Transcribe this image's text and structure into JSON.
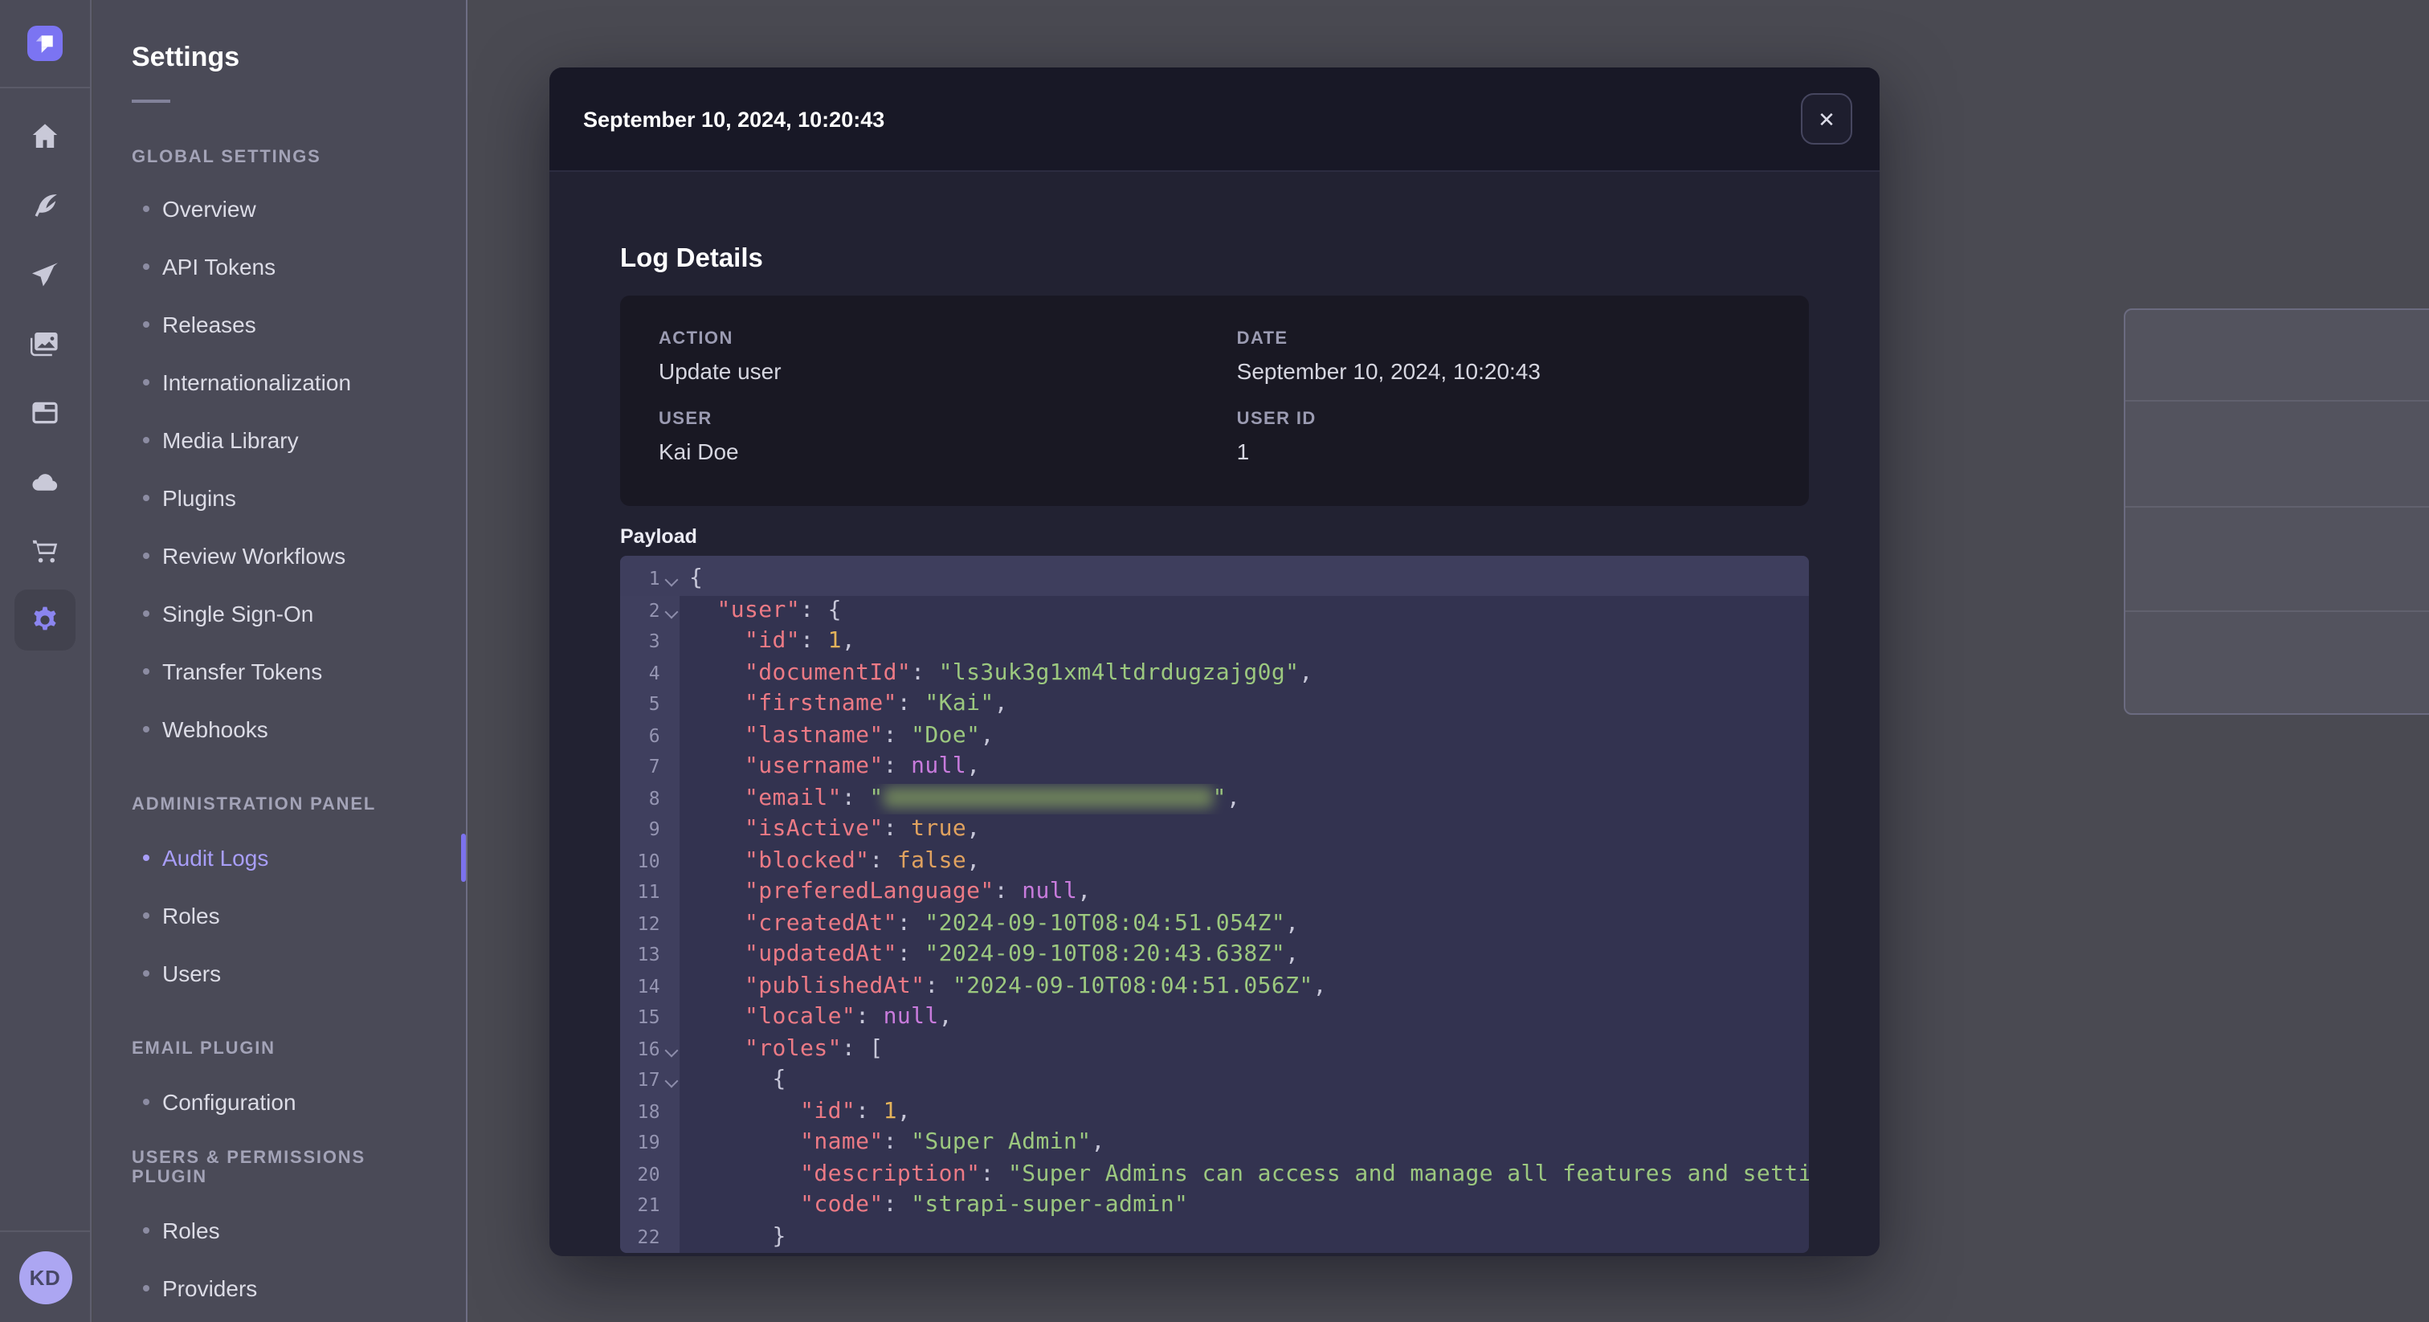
{
  "rail": {
    "logo_icon": "strapi-logo-icon",
    "items": [
      {
        "icon": "home-icon"
      },
      {
        "icon": "feather-icon"
      },
      {
        "icon": "send-icon"
      },
      {
        "icon": "media-library-icon"
      },
      {
        "icon": "layout-icon"
      },
      {
        "icon": "cloud-icon"
      },
      {
        "icon": "cart-icon"
      },
      {
        "icon": "gear-icon",
        "active": true
      }
    ],
    "avatar_initials": "KD"
  },
  "settings_nav": {
    "title": "Settings",
    "sections": [
      {
        "label": "GLOBAL SETTINGS",
        "items": [
          {
            "label": "Overview"
          },
          {
            "label": "API Tokens"
          },
          {
            "label": "Releases"
          },
          {
            "label": "Internationalization"
          },
          {
            "label": "Media Library"
          },
          {
            "label": "Plugins"
          },
          {
            "label": "Review Workflows"
          },
          {
            "label": "Single Sign-On"
          },
          {
            "label": "Transfer Tokens"
          },
          {
            "label": "Webhooks"
          }
        ]
      },
      {
        "label": "ADMINISTRATION PANEL",
        "items": [
          {
            "label": "Audit Logs",
            "active": true
          },
          {
            "label": "Roles"
          },
          {
            "label": "Users"
          }
        ]
      },
      {
        "label": "EMAIL PLUGIN",
        "items": [
          {
            "label": "Configuration"
          }
        ]
      },
      {
        "label": "USERS & PERMISSIONS PLUGIN",
        "items": [
          {
            "label": "Roles"
          },
          {
            "label": "Providers"
          }
        ]
      }
    ]
  },
  "modal": {
    "title": "September 10, 2024, 10:20:43",
    "close_label": "✕",
    "section_heading": "Log Details",
    "details": {
      "action_label": "ACTION",
      "action_value": "Update user",
      "date_label": "DATE",
      "date_value": "September 10, 2024, 10:20:43",
      "user_label": "USER",
      "user_value": "Kai Doe",
      "user_id_label": "USER ID",
      "user_id_value": "1"
    },
    "payload_label": "Payload",
    "payload": {
      "lines": [
        {
          "n": 1,
          "fold": true,
          "active": true,
          "t": [
            [
              "p",
              "{"
            ]
          ]
        },
        {
          "n": 2,
          "fold": true,
          "t": [
            [
              "p",
              "  "
            ],
            [
              "k",
              "\"user\""
            ],
            [
              "p",
              ": {"
            ]
          ]
        },
        {
          "n": 3,
          "t": [
            [
              "p",
              "    "
            ],
            [
              "k",
              "\"id\""
            ],
            [
              "p",
              ": "
            ],
            [
              "n",
              "1"
            ],
            [
              "p",
              ","
            ]
          ]
        },
        {
          "n": 4,
          "t": [
            [
              "p",
              "    "
            ],
            [
              "k",
              "\"documentId\""
            ],
            [
              "p",
              ": "
            ],
            [
              "s",
              "\"ls3uk3g1xm4ltdrdugzajg0g\""
            ],
            [
              "p",
              ","
            ]
          ]
        },
        {
          "n": 5,
          "t": [
            [
              "p",
              "    "
            ],
            [
              "k",
              "\"firstname\""
            ],
            [
              "p",
              ": "
            ],
            [
              "s",
              "\"Kai\""
            ],
            [
              "p",
              ","
            ]
          ]
        },
        {
          "n": 6,
          "t": [
            [
              "p",
              "    "
            ],
            [
              "k",
              "\"lastname\""
            ],
            [
              "p",
              ": "
            ],
            [
              "s",
              "\"Doe\""
            ],
            [
              "p",
              ","
            ]
          ]
        },
        {
          "n": 7,
          "t": [
            [
              "p",
              "    "
            ],
            [
              "k",
              "\"username\""
            ],
            [
              "p",
              ": "
            ],
            [
              "u",
              "null"
            ],
            [
              "p",
              ","
            ]
          ]
        },
        {
          "n": 8,
          "t": [
            [
              "p",
              "    "
            ],
            [
              "k",
              "\"email\""
            ],
            [
              "p",
              ": "
            ],
            [
              "s",
              "\""
            ],
            [
              "blur",
              ""
            ],
            [
              "s",
              "\""
            ],
            [
              "p",
              ","
            ]
          ]
        },
        {
          "n": 9,
          "t": [
            [
              "p",
              "    "
            ],
            [
              "k",
              "\"isActive\""
            ],
            [
              "p",
              ": "
            ],
            [
              "b",
              "true"
            ],
            [
              "p",
              ","
            ]
          ]
        },
        {
          "n": 10,
          "t": [
            [
              "p",
              "    "
            ],
            [
              "k",
              "\"blocked\""
            ],
            [
              "p",
              ": "
            ],
            [
              "b",
              "false"
            ],
            [
              "p",
              ","
            ]
          ]
        },
        {
          "n": 11,
          "t": [
            [
              "p",
              "    "
            ],
            [
              "k",
              "\"preferedLanguage\""
            ],
            [
              "p",
              ": "
            ],
            [
              "u",
              "null"
            ],
            [
              "p",
              ","
            ]
          ]
        },
        {
          "n": 12,
          "t": [
            [
              "p",
              "    "
            ],
            [
              "k",
              "\"createdAt\""
            ],
            [
              "p",
              ": "
            ],
            [
              "s",
              "\"2024-09-10T08:04:51.054Z\""
            ],
            [
              "p",
              ","
            ]
          ]
        },
        {
          "n": 13,
          "t": [
            [
              "p",
              "    "
            ],
            [
              "k",
              "\"updatedAt\""
            ],
            [
              "p",
              ": "
            ],
            [
              "s",
              "\"2024-09-10T08:20:43.638Z\""
            ],
            [
              "p",
              ","
            ]
          ]
        },
        {
          "n": 14,
          "t": [
            [
              "p",
              "    "
            ],
            [
              "k",
              "\"publishedAt\""
            ],
            [
              "p",
              ": "
            ],
            [
              "s",
              "\"2024-09-10T08:04:51.056Z\""
            ],
            [
              "p",
              ","
            ]
          ]
        },
        {
          "n": 15,
          "t": [
            [
              "p",
              "    "
            ],
            [
              "k",
              "\"locale\""
            ],
            [
              "p",
              ": "
            ],
            [
              "u",
              "null"
            ],
            [
              "p",
              ","
            ]
          ]
        },
        {
          "n": 16,
          "fold": true,
          "t": [
            [
              "p",
              "    "
            ],
            [
              "k",
              "\"roles\""
            ],
            [
              "p",
              ": ["
            ]
          ]
        },
        {
          "n": 17,
          "fold": true,
          "t": [
            [
              "p",
              "      {"
            ]
          ]
        },
        {
          "n": 18,
          "t": [
            [
              "p",
              "        "
            ],
            [
              "k",
              "\"id\""
            ],
            [
              "p",
              ": "
            ],
            [
              "n",
              "1"
            ],
            [
              "p",
              ","
            ]
          ]
        },
        {
          "n": 19,
          "t": [
            [
              "p",
              "        "
            ],
            [
              "k",
              "\"name\""
            ],
            [
              "p",
              ": "
            ],
            [
              "s",
              "\"Super Admin\""
            ],
            [
              "p",
              ","
            ]
          ]
        },
        {
          "n": 20,
          "t": [
            [
              "p",
              "        "
            ],
            [
              "k",
              "\"description\""
            ],
            [
              "p",
              ": "
            ],
            [
              "s",
              "\"Super Admins can access and manage all features and settings.\""
            ],
            [
              "p",
              ","
            ]
          ]
        },
        {
          "n": 21,
          "t": [
            [
              "p",
              "        "
            ],
            [
              "k",
              "\"code\""
            ],
            [
              "p",
              ": "
            ],
            [
              "s",
              "\"strapi-super-admin\""
            ]
          ]
        },
        {
          "n": 22,
          "t": [
            [
              "p",
              "      }"
            ]
          ]
        }
      ]
    }
  },
  "background": {
    "table_row_count": 3,
    "row_action_icon": "eye-icon",
    "help_icon": "question-circle-icon"
  },
  "colors": {
    "accent": "#7b74f2",
    "active_link": "#a89ef8",
    "modal_header_bg": "#181826",
    "modal_body_bg": "#222232",
    "details_box_bg": "#191823",
    "code_bg": "#333350",
    "code_key": "#ec7a85",
    "code_string": "#9cc87f",
    "code_number": "#e3b35a",
    "code_boolean": "#e0a25f",
    "code_null": "#c87bdc"
  }
}
